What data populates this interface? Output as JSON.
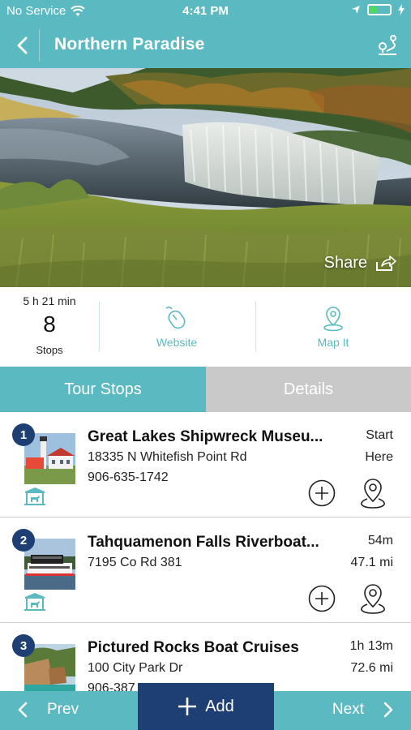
{
  "status_bar": {
    "carrier": "No Service",
    "time": "4:41 PM"
  },
  "header": {
    "title": "Northern Paradise"
  },
  "hero": {
    "share_label": "Share"
  },
  "summary": {
    "duration": "5 h 21 min",
    "stop_count": "8",
    "stops_label": "Stops",
    "website_label": "Website",
    "mapit_label": "Map It"
  },
  "tabs": {
    "active": "Tour Stops",
    "inactive": "Details"
  },
  "stops": [
    {
      "number": "1",
      "name": "Great Lakes Shipwreck Museu...",
      "address": "18335 N Whitefish Point Rd",
      "phone": "906-635-1742",
      "meta_top": "Start",
      "meta_bottom": "Here"
    },
    {
      "number": "2",
      "name": "Tahquamenon Falls Riverboat...",
      "address": "7195 Co Rd 381",
      "phone": "",
      "meta_top": "54m",
      "meta_bottom": "47.1 mi"
    },
    {
      "number": "3",
      "name": "Pictured Rocks Boat Cruises",
      "address": "100 City Park Dr",
      "phone": "906-387",
      "meta_top": "1h 13m",
      "meta_bottom": "72.6 mi"
    }
  ],
  "bottom_bar": {
    "prev_label": "Prev",
    "add_label": "Add",
    "next_label": "Next"
  },
  "colors": {
    "teal": "#5bb9c1",
    "navy": "#1d3f73",
    "tab_inactive": "#c9c9c9"
  }
}
